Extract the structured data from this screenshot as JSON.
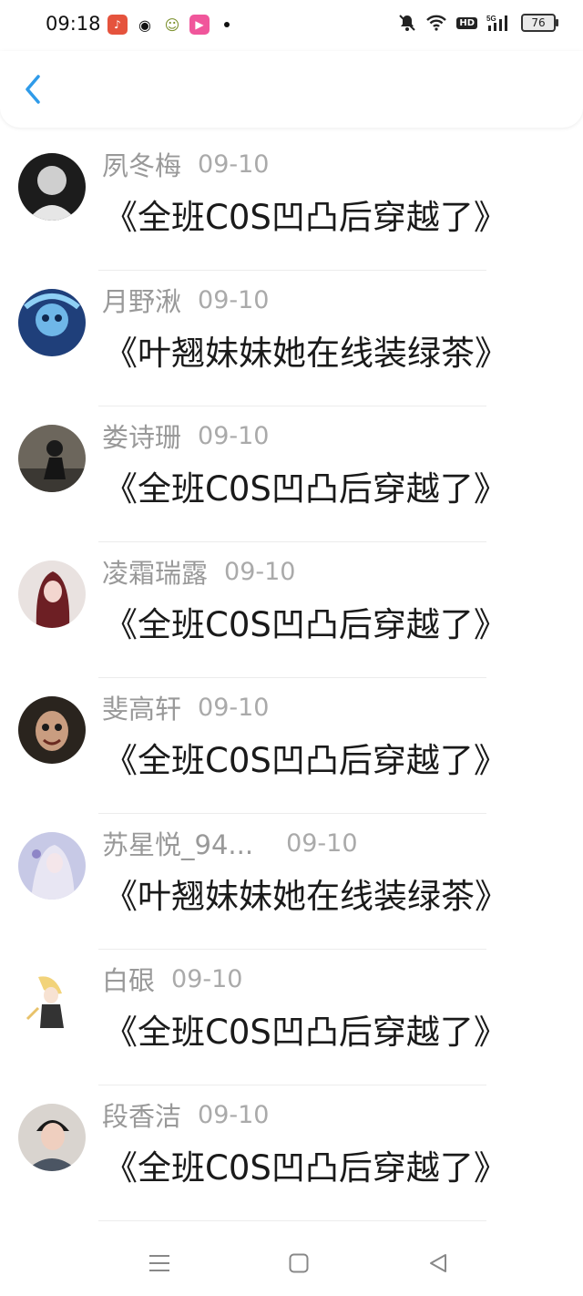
{
  "status_bar": {
    "time": "09:18",
    "battery": "76"
  },
  "comments": [
    {
      "name": "夙冬梅",
      "date": "09-10",
      "text": "《全班C0S凹凸后穿越了》"
    },
    {
      "name": "月野湫",
      "date": "09-10",
      "text": "《叶翘妹妹她在线装绿茶》"
    },
    {
      "name": "娄诗珊",
      "date": "09-10",
      "text": "《全班C0S凹凸后穿越了》"
    },
    {
      "name": "凌霜瑞露",
      "date": "09-10",
      "text": "《全班C0S凹凸后穿越了》"
    },
    {
      "name": "斐高轩",
      "date": "09-10",
      "text": "《全班C0S凹凸后穿越了》"
    },
    {
      "name": "苏星悦_94...",
      "date": "09-10",
      "text": "《叶翘妹妹她在线装绿茶》"
    },
    {
      "name": "白硍",
      "date": "09-10",
      "text": "《全班C0S凹凸后穿越了》"
    },
    {
      "name": "段香洁",
      "date": "09-10",
      "text": "《全班C0S凹凸后穿越了》"
    }
  ],
  "colors": {
    "accent": "#2f9be9",
    "name": "#999999",
    "text": "#1a1a1a"
  }
}
